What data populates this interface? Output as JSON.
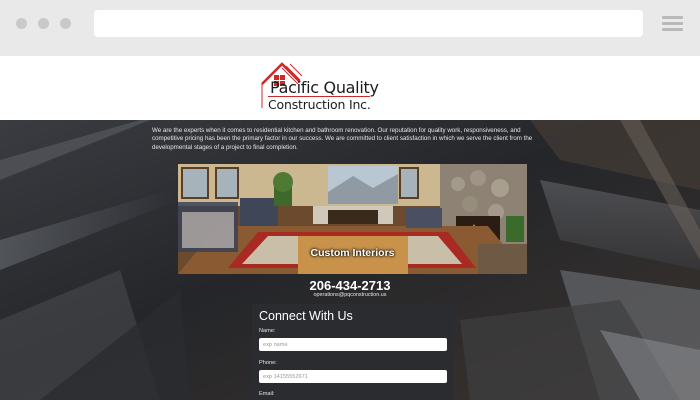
{
  "browser": {
    "url": ""
  },
  "logo": {
    "line1": "Pacific Quality",
    "line2": "Construction Inc."
  },
  "intro": {
    "text": "We are the experts when it comes to residential kitchen and bathroom renovation. Our reputation for quality work, responsiveness, and competitive pricing has been the primary factor in our success. We are committed to client satisfaction in which we serve the client from the developmental stages of a project to final completion."
  },
  "hero": {
    "caption": "Custom Interiors"
  },
  "contact": {
    "phone": "206-434-2713",
    "email": "operations@pqconstruction.us"
  },
  "form": {
    "title": "Connect With Us",
    "name_label": "Name:",
    "name_placeholder": "exp name",
    "phone_label": "Phone:",
    "phone_placeholder": "exp 14155552671",
    "email_label": "Email:"
  },
  "colors": {
    "brand_red": "#cc2a2a",
    "page_dark": "#2f3237"
  }
}
